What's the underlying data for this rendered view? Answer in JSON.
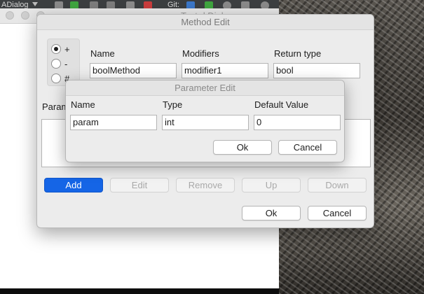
{
  "ide": {
    "dialog_label": "ADialog",
    "git_label": "Git:",
    "window_title": "Test d Dial"
  },
  "method_dialog": {
    "title": "Method Edit",
    "visibility": {
      "options": [
        {
          "label": "+",
          "checked": true
        },
        {
          "label": "-",
          "checked": false
        },
        {
          "label": "#",
          "checked": false
        }
      ]
    },
    "fields": {
      "name_label": "Name",
      "name_value": "boolMethod",
      "modifiers_label": "Modifiers",
      "modifiers_value": "modifier1",
      "return_type_label": "Return type",
      "return_type_value": "bool"
    },
    "params_label": "Param",
    "buttons": {
      "add": "Add",
      "edit": "Edit",
      "remove": "Remove",
      "up": "Up",
      "down": "Down",
      "ok": "Ok",
      "cancel": "Cancel"
    }
  },
  "param_dialog": {
    "title": "Parameter Edit",
    "name_label": "Name",
    "name_value": "param",
    "type_label": "Type",
    "type_value": "int",
    "default_label": "Default Value",
    "default_value": "0",
    "ok": "Ok",
    "cancel": "Cancel"
  },
  "colors": {
    "primary_button": "#1565e6",
    "dialog_bg": "#ececec"
  }
}
